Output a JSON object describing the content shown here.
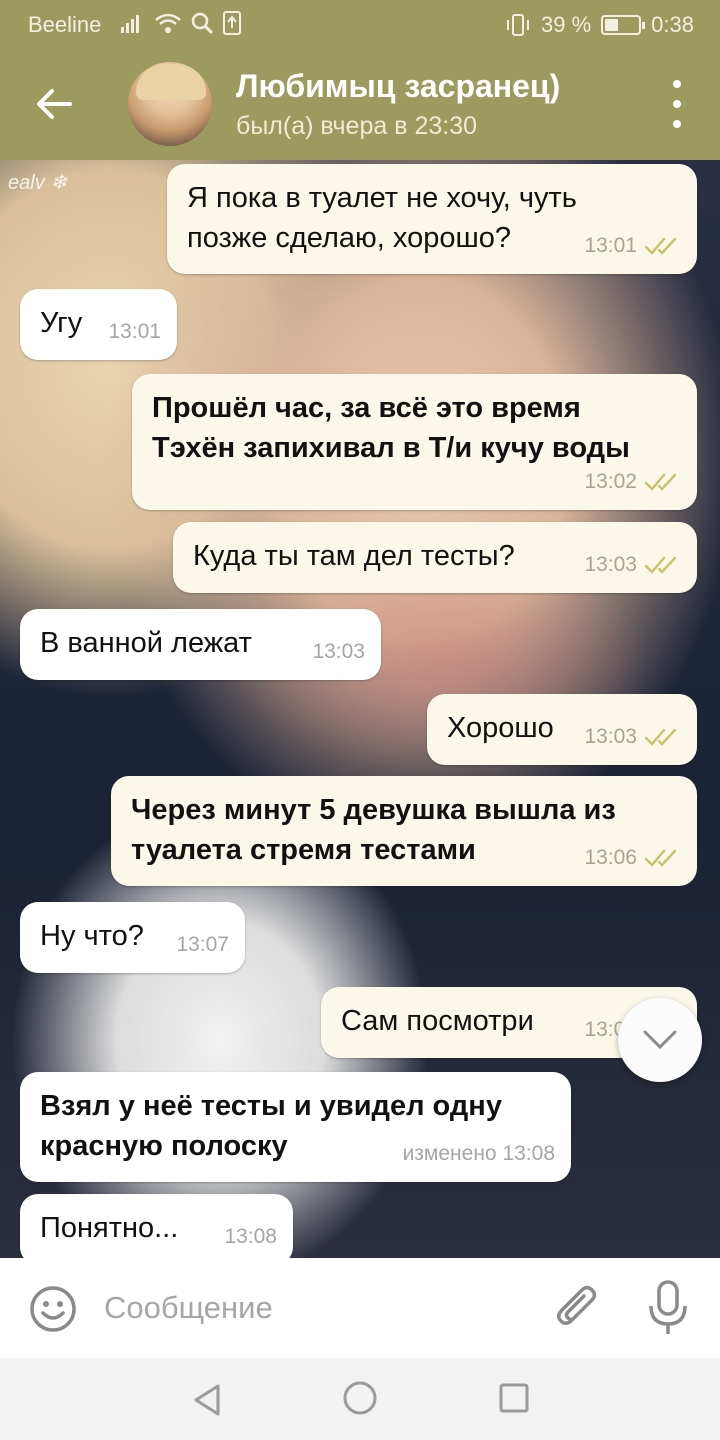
{
  "status_bar": {
    "carrier": "Beeline",
    "battery_text": "39 %",
    "battery_level": 0.39,
    "time": "0:38"
  },
  "header": {
    "contact_name": "Любимыц засранец)",
    "last_seen": "был(а) вчера в 23:30"
  },
  "background": {
    "watermark": "ealv ❄"
  },
  "messages": [
    {
      "direction": "out",
      "text": "Я пока в туалет не хочу, чуть\nпозже сделаю, хорошо?",
      "time": "13:01",
      "read": true
    },
    {
      "direction": "in",
      "text": "Угу",
      "time": "13:01"
    },
    {
      "direction": "out",
      "bold": true,
      "text": "Прошёл час, за всё это время\nТэхён запихивал в Т/и кучу воды",
      "time": "13:02",
      "read": true
    },
    {
      "direction": "out",
      "text": "Куда ты там дел тесты?",
      "time": "13:03",
      "read": true
    },
    {
      "direction": "in",
      "text": "В ванной лежат",
      "time": "13:03"
    },
    {
      "direction": "out",
      "text": "Хорошо",
      "time": "13:03",
      "read": true
    },
    {
      "direction": "out",
      "bold": true,
      "text": "Через минут 5 девушка вышла из\nтуалета стремя тестами",
      "time": "13:06",
      "read": true
    },
    {
      "direction": "in",
      "text": "Ну что?",
      "time": "13:07"
    },
    {
      "direction": "out",
      "text": "Сам посмотри",
      "time": "13:07",
      "read": true
    },
    {
      "direction": "in",
      "bold": true,
      "text": "Взял у неё тесты и увидел одну\nкрасную полоску",
      "time": "изменено 13:08"
    },
    {
      "direction": "in",
      "text": "Понятно...",
      "time": "13:08"
    }
  ],
  "input": {
    "placeholder": "Сообщение"
  },
  "icons": {
    "back": "arrow-left-icon",
    "menu": "more-vert-icon",
    "scroll": "chevron-down-icon",
    "emoji": "smile-icon",
    "attach": "paperclip-icon",
    "mic": "microphone-icon"
  },
  "colors": {
    "header": "#9c9a5e",
    "bubble_out": "#fbf8ea",
    "bubble_in": "#ffffff",
    "read_check": "#c9c06a"
  }
}
